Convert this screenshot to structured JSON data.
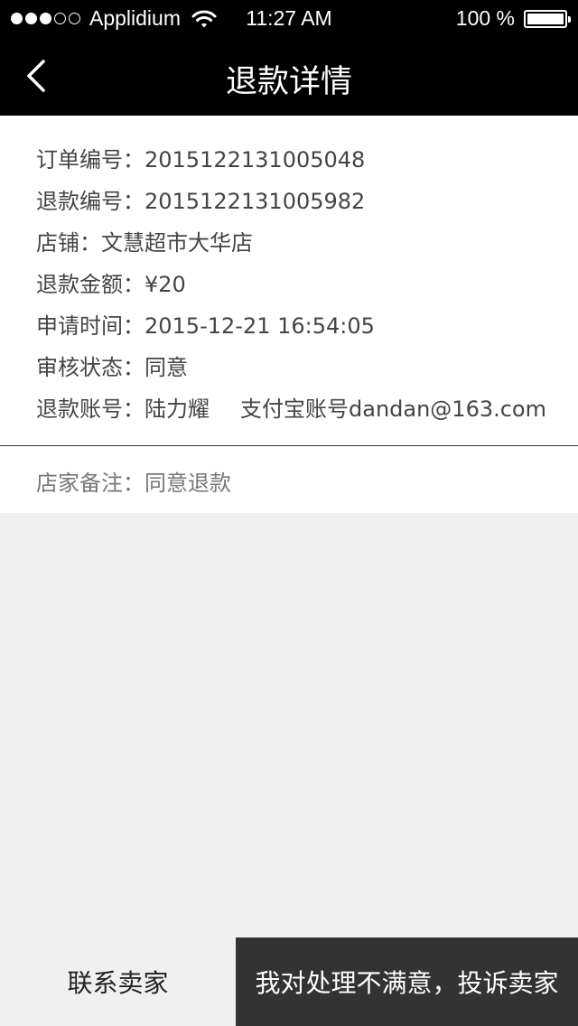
{
  "status_bar": {
    "carrier": "Applidium",
    "time": "11:27 AM",
    "battery": "100 %",
    "battery_level": 1.0,
    "signal_bars_filled": 3,
    "signal_bars_total": 5
  },
  "nav": {
    "title": "退款详情",
    "back_icon": "chevron-left-icon"
  },
  "details": {
    "order_no_label": "订单编号：",
    "order_no": "2015122131005048",
    "refund_no_label": "退款编号：",
    "refund_no": "2015122131005982",
    "shop_label": "店铺：",
    "shop": "文慧超市大华店",
    "amount_label": "退款金额：",
    "amount": "¥20",
    "apply_time_label": "申请时间：",
    "apply_time": "2015-12-21 16:54:05",
    "review_status_label": "审核状态：",
    "review_status": "同意",
    "refund_account_label": "退款账号：",
    "account_name": "陆力耀",
    "account_detail": "支付宝账号dandan@163.com"
  },
  "note": {
    "label": "店家备注：",
    "value": "同意退款"
  },
  "bottom": {
    "contact_label": "联系卖家",
    "complain_label": "我对处理不满意，投诉卖家"
  },
  "colors": {
    "nav_background": "#000000",
    "complain_background": "#333333"
  }
}
